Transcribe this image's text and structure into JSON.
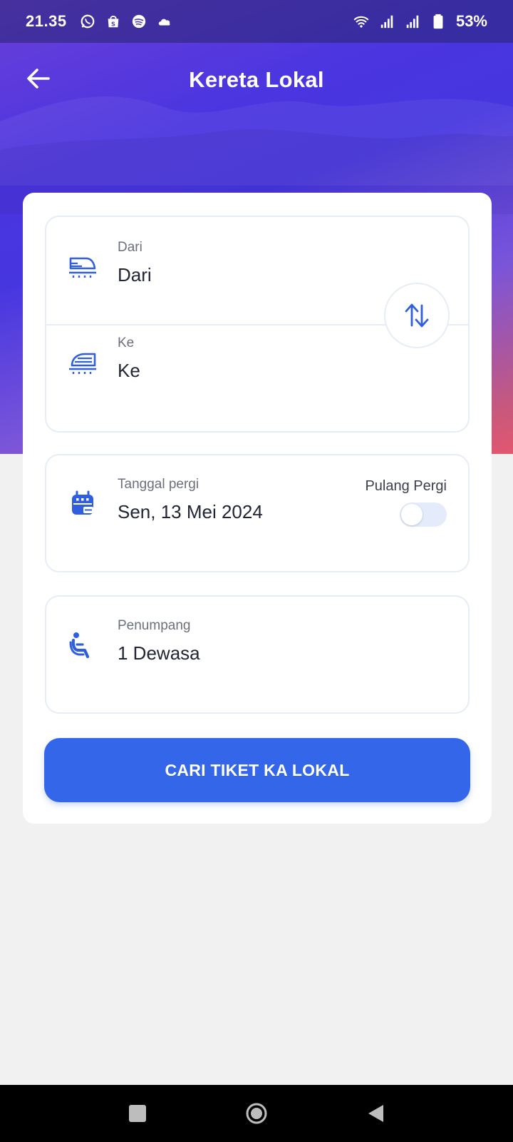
{
  "status_bar": {
    "time": "21.35",
    "battery": "53%",
    "left_icons": [
      "whatsapp-icon",
      "shop-bag-icon",
      "spotify-icon",
      "cloud-icon"
    ],
    "right_icons": [
      "wifi-icon",
      "signal-icon",
      "signal-icon",
      "battery-icon"
    ]
  },
  "app_bar": {
    "title": "Kereta Lokal",
    "back_icon": "arrow-left-icon"
  },
  "route": {
    "from": {
      "label": "Dari",
      "value": "Dari",
      "icon": "train-icon"
    },
    "to": {
      "label": "Ke",
      "value": "Ke",
      "icon": "train-icon"
    },
    "swap_icon": "swap-vertical-icon"
  },
  "date": {
    "label": "Tanggal pergi",
    "value": "Sen, 13 Mei 2024",
    "icon": "calendar-icon",
    "round_trip_label": "Pulang Pergi",
    "round_trip_enabled": false
  },
  "passenger": {
    "label": "Penumpang",
    "value": "1 Dewasa",
    "icon": "seat-passenger-icon"
  },
  "search_button": {
    "label": "CARI TIKET KA LOKAL"
  },
  "colors": {
    "primary": "#3466ea",
    "icon_blue": "#2f5fe0",
    "border": "#e6edf7",
    "background": "#f1f1f2"
  },
  "nav_bar": {
    "buttons": [
      "recent-apps-icon",
      "home-icon",
      "back-icon"
    ]
  }
}
